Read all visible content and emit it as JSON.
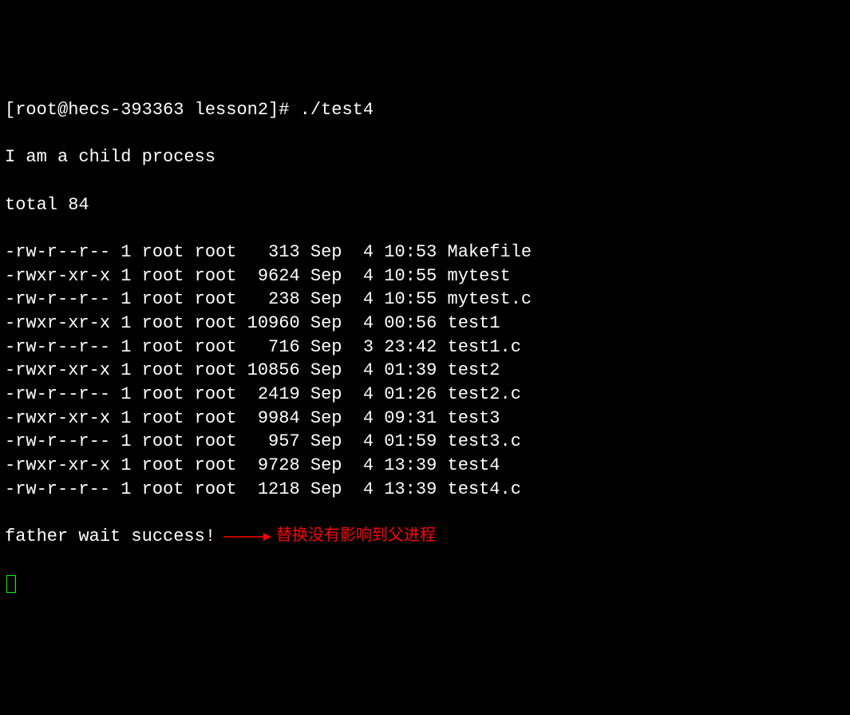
{
  "prompt": "[root@hecs-393363 lesson2]# ./test4",
  "child_msg": "I am a child process",
  "total_line": "total 84",
  "files": [
    {
      "perm": "-rw-r--r--",
      "links": "1",
      "owner": "root",
      "group": "root",
      "size": "313",
      "month": "Sep",
      "day": "4",
      "time": "10:53",
      "name": "Makefile"
    },
    {
      "perm": "-rwxr-xr-x",
      "links": "1",
      "owner": "root",
      "group": "root",
      "size": "9624",
      "month": "Sep",
      "day": "4",
      "time": "10:55",
      "name": "mytest"
    },
    {
      "perm": "-rw-r--r--",
      "links": "1",
      "owner": "root",
      "group": "root",
      "size": "238",
      "month": "Sep",
      "day": "4",
      "time": "10:55",
      "name": "mytest.c"
    },
    {
      "perm": "-rwxr-xr-x",
      "links": "1",
      "owner": "root",
      "group": "root",
      "size": "10960",
      "month": "Sep",
      "day": "4",
      "time": "00:56",
      "name": "test1"
    },
    {
      "perm": "-rw-r--r--",
      "links": "1",
      "owner": "root",
      "group": "root",
      "size": "716",
      "month": "Sep",
      "day": "3",
      "time": "23:42",
      "name": "test1.c"
    },
    {
      "perm": "-rwxr-xr-x",
      "links": "1",
      "owner": "root",
      "group": "root",
      "size": "10856",
      "month": "Sep",
      "day": "4",
      "time": "01:39",
      "name": "test2"
    },
    {
      "perm": "-rw-r--r--",
      "links": "1",
      "owner": "root",
      "group": "root",
      "size": "2419",
      "month": "Sep",
      "day": "4",
      "time": "01:26",
      "name": "test2.c"
    },
    {
      "perm": "-rwxr-xr-x",
      "links": "1",
      "owner": "root",
      "group": "root",
      "size": "9984",
      "month": "Sep",
      "day": "4",
      "time": "09:31",
      "name": "test3"
    },
    {
      "perm": "-rw-r--r--",
      "links": "1",
      "owner": "root",
      "group": "root",
      "size": "957",
      "month": "Sep",
      "day": "4",
      "time": "01:59",
      "name": "test3.c"
    },
    {
      "perm": "-rwxr-xr-x",
      "links": "1",
      "owner": "root",
      "group": "root",
      "size": "9728",
      "month": "Sep",
      "day": "4",
      "time": "13:39",
      "name": "test4"
    },
    {
      "perm": "-rw-r--r--",
      "links": "1",
      "owner": "root",
      "group": "root",
      "size": "1218",
      "month": "Sep",
      "day": "4",
      "time": "13:39",
      "name": "test4.c"
    }
  ],
  "father_msg": "father wait success!",
  "annotation": "替换没有影响到父进程"
}
